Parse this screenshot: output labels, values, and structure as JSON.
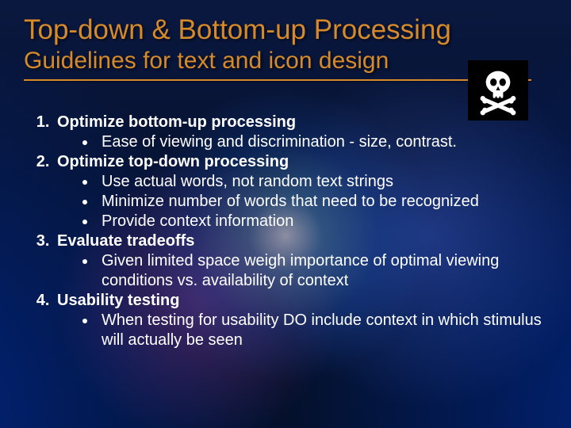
{
  "title": "Top-down & Bottom-up Processing",
  "subtitle": "Guidelines for text and icon design",
  "icon_name": "skull-crossbones-icon",
  "items": [
    {
      "heading": "Optimize bottom-up processing",
      "bullets": [
        "Ease of viewing and discrimination - size, contrast."
      ]
    },
    {
      "heading": "Optimize top-down processing",
      "bullets": [
        "Use actual words, not random text strings",
        "Minimize number of words that need to be recognized",
        "Provide context information"
      ]
    },
    {
      "heading": "Evaluate tradeoffs",
      "bullets": [
        "Given limited space weigh importance of optimal viewing conditions vs. availability of context"
      ]
    },
    {
      "heading": "Usability testing",
      "bullets": [
        "When testing for usability DO include context in which stimulus will actually be seen"
      ]
    }
  ]
}
